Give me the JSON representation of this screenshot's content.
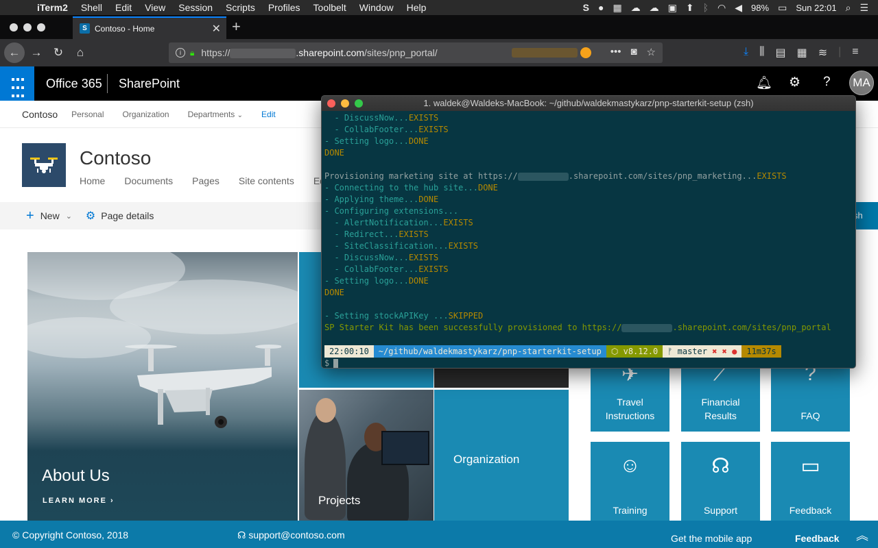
{
  "menubar": {
    "app_name": "iTerm2",
    "items": [
      "Shell",
      "Edit",
      "View",
      "Session",
      "Scripts",
      "Profiles",
      "Toolbelt",
      "Window",
      "Help"
    ],
    "battery": "98%",
    "clock": "Sun 22:01"
  },
  "browser": {
    "tab_title": "Contoso - Home",
    "url_prefix": "https://",
    "url_host": ".sharepoint.com",
    "url_path": "/sites/pnp_portal/"
  },
  "suitebar": {
    "office": "Office 365",
    "sharepoint": "SharePoint",
    "avatar_initials": "MA"
  },
  "hubnav": {
    "title": "Contoso",
    "items": [
      "Personal",
      "Organization",
      "Departments"
    ],
    "edit": "Edit"
  },
  "site": {
    "title": "Contoso",
    "nav": [
      "Home",
      "Documents",
      "Pages",
      "Site contents",
      "Edit"
    ]
  },
  "commandbar": {
    "new": "New",
    "page_details": "Page details",
    "publish_partial": "sh"
  },
  "hero": {
    "about_title": "About Us",
    "learn_more": "LEARN MORE",
    "projects": "Projects",
    "organization": "Organization"
  },
  "quicklinks": [
    {
      "label1": "Travel",
      "label2": "Instructions",
      "icon": "airplane-icon"
    },
    {
      "label1": "Financial",
      "label2": "Results",
      "icon": "chart-icon"
    },
    {
      "label1": "FAQ",
      "label2": "",
      "icon": "question-icon"
    },
    {
      "label1": "Training",
      "label2": "",
      "icon": "training-icon"
    },
    {
      "label1": "Support",
      "label2": "",
      "icon": "headset-icon"
    },
    {
      "label1": "Feedback",
      "label2": "",
      "icon": "feedback-icon"
    }
  ],
  "footer": {
    "copyright": "© Copyright Contoso, 2018",
    "support": "support@contoso.com",
    "mobile": "Get the mobile app",
    "feedback": "Feedback"
  },
  "terminal": {
    "title": "1. waldek@Waldeks-MacBook: ~/github/waldekmastykarz/pnp-starterkit-setup (zsh)",
    "lines": [
      {
        "parts": [
          {
            "t": "  - DiscussNow...",
            "c": "cyan"
          },
          {
            "t": "EXISTS",
            "c": "yellow"
          }
        ]
      },
      {
        "parts": [
          {
            "t": "  - CollabFooter...",
            "c": "cyan"
          },
          {
            "t": "EXISTS",
            "c": "yellow"
          }
        ]
      },
      {
        "parts": [
          {
            "t": "- Setting logo...",
            "c": "cyan"
          },
          {
            "t": "DONE",
            "c": "yellow"
          }
        ]
      },
      {
        "parts": [
          {
            "t": "DONE",
            "c": "yellow"
          }
        ]
      },
      {
        "parts": []
      },
      {
        "parts": [
          {
            "t": "Provisioning marketing site at https://",
            "c": "text"
          },
          {
            "t": "",
            "c": "blur"
          },
          {
            "t": ".sharepoint.com/sites/pnp_marketing...",
            "c": "text"
          },
          {
            "t": "EXISTS",
            "c": "yellow"
          }
        ]
      },
      {
        "parts": [
          {
            "t": "- Connecting to the hub site...",
            "c": "cyan"
          },
          {
            "t": "DONE",
            "c": "yellow"
          }
        ]
      },
      {
        "parts": [
          {
            "t": "- Applying theme...",
            "c": "cyan"
          },
          {
            "t": "DONE",
            "c": "yellow"
          }
        ]
      },
      {
        "parts": [
          {
            "t": "- Configuring extensions...",
            "c": "cyan"
          }
        ]
      },
      {
        "parts": [
          {
            "t": "  - AlertNotification...",
            "c": "cyan"
          },
          {
            "t": "EXISTS",
            "c": "yellow"
          }
        ]
      },
      {
        "parts": [
          {
            "t": "  - Redirect...",
            "c": "cyan"
          },
          {
            "t": "EXISTS",
            "c": "yellow"
          }
        ]
      },
      {
        "parts": [
          {
            "t": "  - SiteClassification...",
            "c": "cyan"
          },
          {
            "t": "EXISTS",
            "c": "yellow"
          }
        ]
      },
      {
        "parts": [
          {
            "t": "  - DiscussNow...",
            "c": "cyan"
          },
          {
            "t": "EXISTS",
            "c": "yellow"
          }
        ]
      },
      {
        "parts": [
          {
            "t": "  - CollabFooter...",
            "c": "cyan"
          },
          {
            "t": "EXISTS",
            "c": "yellow"
          }
        ]
      },
      {
        "parts": [
          {
            "t": "- Setting logo...",
            "c": "cyan"
          },
          {
            "t": "DONE",
            "c": "yellow"
          }
        ]
      },
      {
        "parts": [
          {
            "t": "DONE",
            "c": "yellow"
          }
        ]
      },
      {
        "parts": []
      },
      {
        "parts": [
          {
            "t": "- Setting stockAPIKey ...",
            "c": "cyan"
          },
          {
            "t": "SKIPPED",
            "c": "yellow"
          }
        ]
      },
      {
        "parts": [
          {
            "t": "SP Starter Kit has been successfully provisioned to https://",
            "c": "green"
          },
          {
            "t": "",
            "c": "blur"
          },
          {
            "t": ".sharepoint.com/sites/pnp_portal",
            "c": "green"
          }
        ]
      },
      {
        "parts": []
      }
    ],
    "prompt": {
      "time": "22:00:10",
      "path": "~/github/waldekmastykarz/pnp-starterkit-setup",
      "node": "⬡ v8.12.0",
      "git": "master",
      "git_flags": "✖ ✖ ●",
      "duration": "11m37s",
      "dollar": "$"
    }
  }
}
